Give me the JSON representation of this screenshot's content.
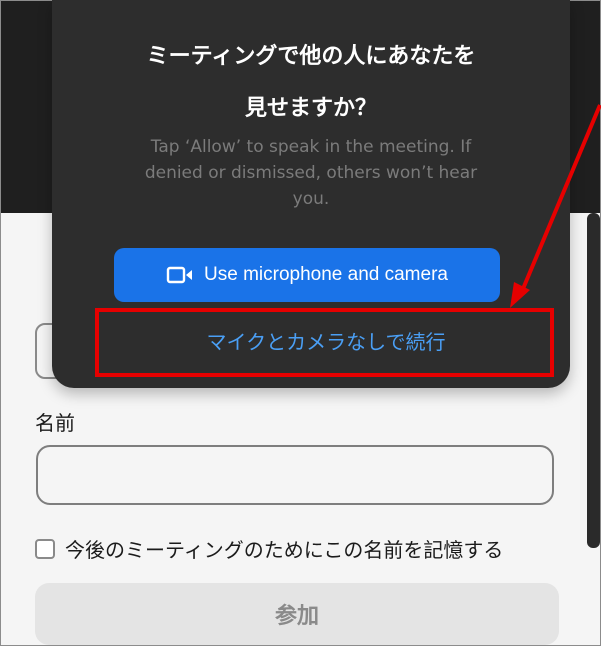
{
  "dialog": {
    "title_line1": "ミーティングで他の人にあなたを",
    "title_line2": "見せますか？",
    "description": "Tap ‘Allow’ to speak in the meeting. If denied or dismissed, others won’t hear you.",
    "primary_button": {
      "label": "Use microphone and camera",
      "icon": "video-camera-icon"
    },
    "secondary_button": {
      "label": "マイクとカメラなしで続行"
    }
  },
  "form": {
    "name_label": "名前",
    "name_value": "",
    "remember_label": "今後のミーティングのためにこの名前を記憶する",
    "remember_checked": false,
    "join_button": "参加"
  },
  "colors": {
    "accent": "#1a73e8",
    "link": "#4a9ff5",
    "dialog_bg": "#2d2d2d",
    "annotation": "#e60000"
  }
}
